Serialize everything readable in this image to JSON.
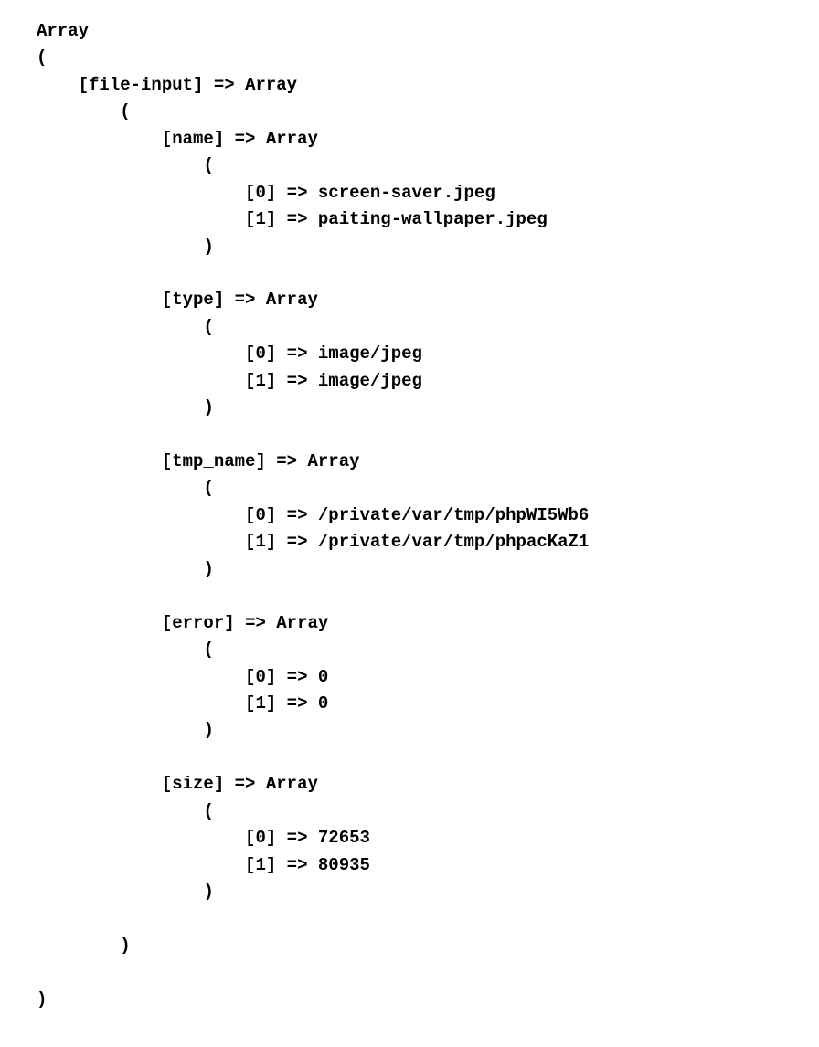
{
  "dump": {
    "root_label": "Array",
    "open_paren": "(",
    "close_paren": ")",
    "arrow": "=>",
    "file_input_key": "[file-input]",
    "file_input_type": "Array",
    "keys": {
      "name": "[name]",
      "type": "[type]",
      "tmp_name": "[tmp_name]",
      "error": "[error]",
      "size": "[size]"
    },
    "inner_type": "Array",
    "idx0": "[0]",
    "idx1": "[1]",
    "values": {
      "name": [
        "screen-saver.jpeg",
        "paiting-wallpaper.jpeg"
      ],
      "type": [
        "image/jpeg",
        "image/jpeg"
      ],
      "tmp_name": [
        "/private/var/tmp/phpWI5Wb6",
        "/private/var/tmp/phpacKaZ1"
      ],
      "error": [
        "0",
        "0"
      ],
      "size": [
        "72653",
        "80935"
      ]
    }
  }
}
